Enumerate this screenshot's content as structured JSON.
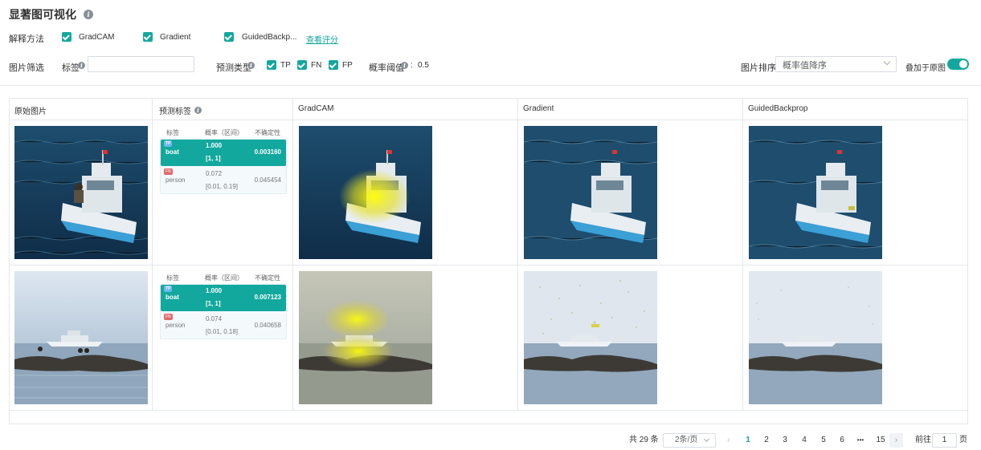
{
  "header": {
    "title": "显著图可视化",
    "info_icon": "info-icon"
  },
  "explain": {
    "label": "解释方法",
    "methods": [
      {
        "label": "GradCAM",
        "checked": true
      },
      {
        "label": "Gradient",
        "checked": true
      },
      {
        "label": "GuidedBackp...",
        "checked": true
      }
    ],
    "view_score_link": "查看评分"
  },
  "filter": {
    "label": "图片筛选",
    "tag_label": "标签",
    "tag_value": "",
    "pred_type_label": "预测类型",
    "pred_types": [
      {
        "label": "TP",
        "checked": true
      },
      {
        "label": "FN",
        "checked": true
      },
      {
        "label": "FP",
        "checked": true
      }
    ],
    "threshold_label": "概率阈值",
    "threshold_sep": ":",
    "threshold_value": "0.5",
    "sort_label": "图片排序",
    "sort_value": "概率值降序",
    "overlay_label": "叠加于原图",
    "overlay_on": true
  },
  "table": {
    "columns": [
      "原始图片",
      "预测标签",
      "GradCAM",
      "Gradient",
      "GuidedBackprop"
    ],
    "pred_headers": {
      "tag": "标签",
      "prob": "概率（区间）",
      "unc": "不确定性"
    },
    "rows": [
      {
        "image": "boat-on-water",
        "preds": [
          {
            "badge": "TP",
            "name": "boat",
            "prob": "1.000",
            "interval": "[1, 1]",
            "unc": "0.003160"
          },
          {
            "badge": "FN",
            "name": "person",
            "prob": "0.072",
            "interval": "[0.01, 0.19]",
            "unc": "0.045454"
          }
        ]
      },
      {
        "image": "yacht-and-rocks",
        "preds": [
          {
            "badge": "TP",
            "name": "boat",
            "prob": "1.000",
            "interval": "[1, 1]",
            "unc": "0.007123"
          },
          {
            "badge": "FN",
            "name": "person",
            "prob": "0.074",
            "interval": "[0.01, 0.18]",
            "unc": "0.040658"
          }
        ]
      }
    ]
  },
  "pagination": {
    "total": "共 29 条",
    "page_size": "2条/页",
    "pages": [
      "1",
      "2",
      "3",
      "4",
      "5",
      "6",
      "•••",
      "15"
    ],
    "current_page": "1",
    "goto_label": "前往",
    "goto_value": "1",
    "page_suffix": "页",
    "prev_icon": "chevron-left-icon",
    "next_icon": "chevron-right-icon"
  },
  "colors": {
    "accent": "#13a89e",
    "tp_badge": "#6bb8f0",
    "fn_badge": "#e06a6a"
  }
}
